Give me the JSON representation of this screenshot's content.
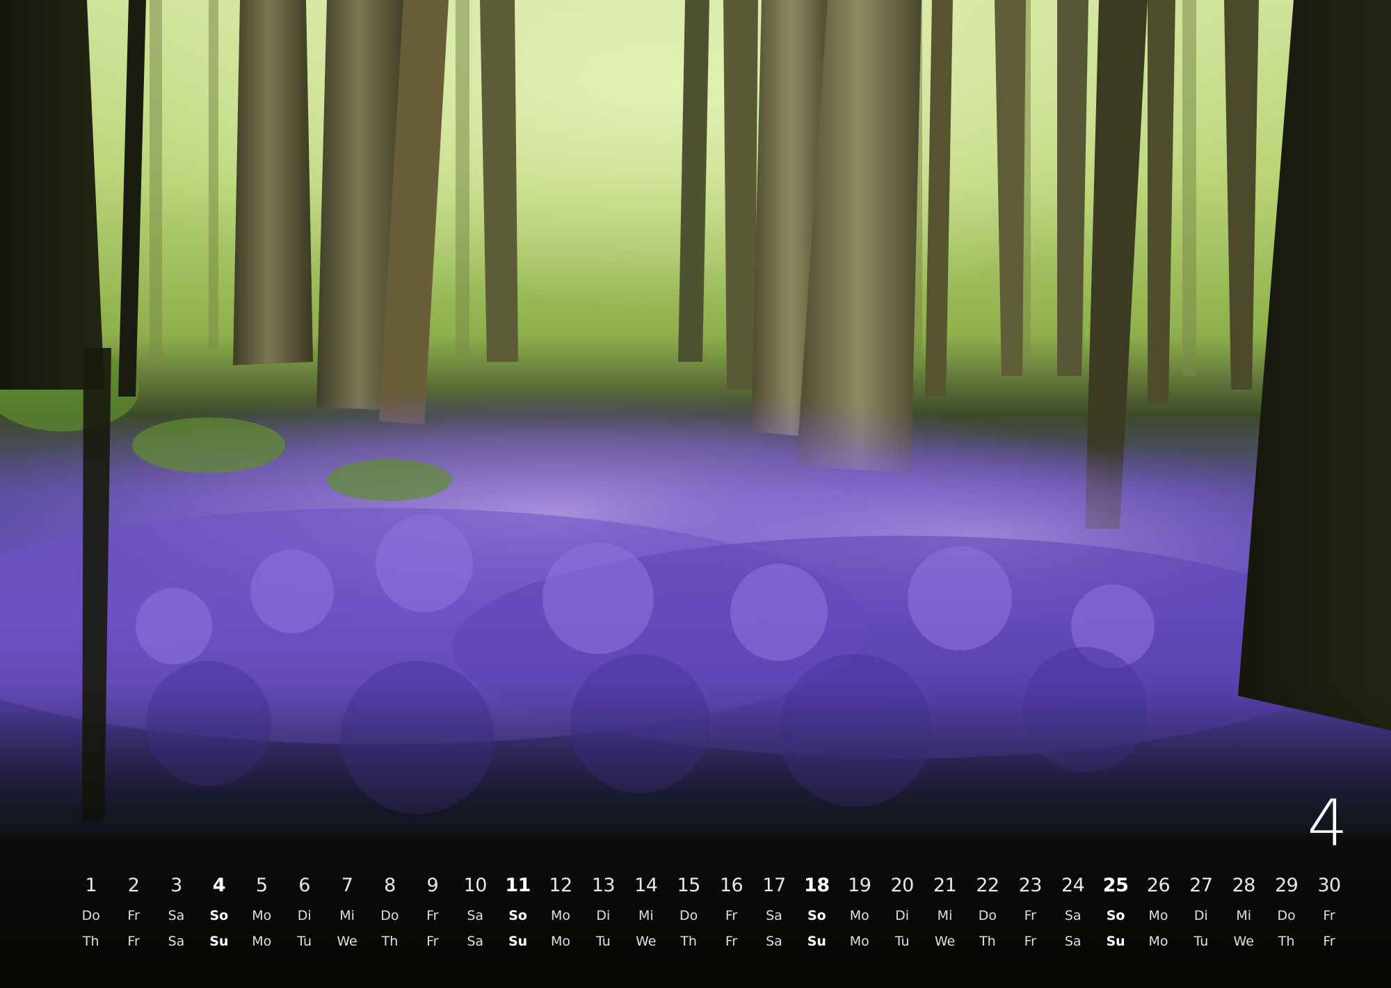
{
  "calendar": {
    "month_number": "4",
    "days": [
      {
        "num": "1",
        "de": "Do",
        "en": "Th",
        "sunday": false
      },
      {
        "num": "2",
        "de": "Fr",
        "en": "Fr",
        "sunday": false
      },
      {
        "num": "3",
        "de": "Sa",
        "en": "Sa",
        "sunday": false
      },
      {
        "num": "4",
        "de": "So",
        "en": "Su",
        "sunday": true
      },
      {
        "num": "5",
        "de": "Mo",
        "en": "Mo",
        "sunday": false
      },
      {
        "num": "6",
        "de": "Di",
        "en": "Tu",
        "sunday": false
      },
      {
        "num": "7",
        "de": "Mi",
        "en": "We",
        "sunday": false
      },
      {
        "num": "8",
        "de": "Do",
        "en": "Th",
        "sunday": false
      },
      {
        "num": "9",
        "de": "Fr",
        "en": "Fr",
        "sunday": false
      },
      {
        "num": "10",
        "de": "Sa",
        "en": "Sa",
        "sunday": false
      },
      {
        "num": "11",
        "de": "So",
        "en": "Su",
        "sunday": true
      },
      {
        "num": "12",
        "de": "Mo",
        "en": "Mo",
        "sunday": false
      },
      {
        "num": "13",
        "de": "Di",
        "en": "Tu",
        "sunday": false
      },
      {
        "num": "14",
        "de": "Mi",
        "en": "We",
        "sunday": false
      },
      {
        "num": "15",
        "de": "Do",
        "en": "Th",
        "sunday": false
      },
      {
        "num": "16",
        "de": "Fr",
        "en": "Fr",
        "sunday": false
      },
      {
        "num": "17",
        "de": "Sa",
        "en": "Sa",
        "sunday": false
      },
      {
        "num": "18",
        "de": "So",
        "en": "Su",
        "sunday": true
      },
      {
        "num": "19",
        "de": "Mo",
        "en": "Mo",
        "sunday": false
      },
      {
        "num": "20",
        "de": "Di",
        "en": "Tu",
        "sunday": false
      },
      {
        "num": "21",
        "de": "Mi",
        "en": "We",
        "sunday": false
      },
      {
        "num": "22",
        "de": "Do",
        "en": "Th",
        "sunday": false
      },
      {
        "num": "23",
        "de": "Fr",
        "en": "Fr",
        "sunday": false
      },
      {
        "num": "24",
        "de": "Sa",
        "en": "Sa",
        "sunday": false
      },
      {
        "num": "25",
        "de": "So",
        "en": "Su",
        "sunday": true
      },
      {
        "num": "26",
        "de": "Mo",
        "en": "Mo",
        "sunday": false
      },
      {
        "num": "27",
        "de": "Di",
        "en": "Tu",
        "sunday": false
      },
      {
        "num": "28",
        "de": "Mi",
        "en": "We",
        "sunday": false
      },
      {
        "num": "29",
        "de": "Do",
        "en": "Th",
        "sunday": false
      },
      {
        "num": "30",
        "de": "Fr",
        "en": "Fr",
        "sunday": false
      }
    ]
  },
  "colors": {
    "text": "#ffffff",
    "bluebell": "#6f52c8",
    "foliage": "#b7d46a",
    "trunk": "#5d5a3c",
    "ground": "#0b0f06"
  }
}
